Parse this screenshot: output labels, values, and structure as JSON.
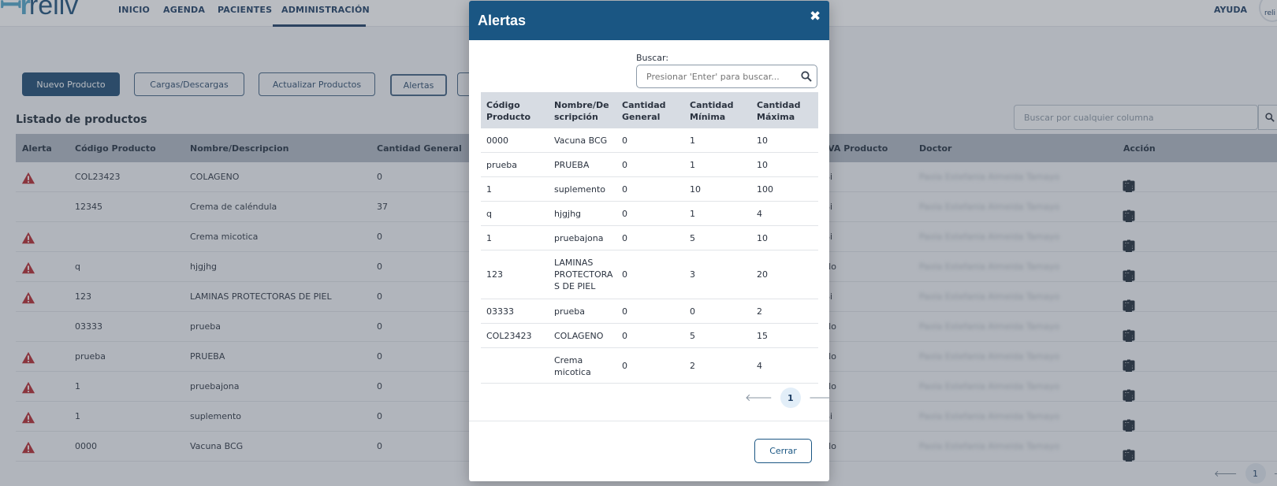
{
  "nav": {
    "logo": "reliv",
    "items": [
      "INICIO",
      "AGENDA",
      "PACIENTES",
      "ADMINISTRACIÓN"
    ],
    "help": "AYUDA",
    "avatar_text": "reli"
  },
  "toolbar": {
    "new_product": "Nuevo Producto",
    "loads": "Cargas/Descargas",
    "update_products": "Actualizar Productos",
    "alerts": "Alertas"
  },
  "list": {
    "title": "Listado de productos",
    "search_placeholder": "Buscar por cualquier columna",
    "columns": [
      "Alerta",
      "Código Producto",
      "Nombre/Descripcion",
      "Cantidad General",
      "IVA Producto",
      "Doctor",
      "Acción"
    ],
    "rows": [
      {
        "alert": true,
        "code": "COL23423",
        "name": "COLAGENO",
        "qty": "0",
        "iva": "Si",
        "doctor": "Paola Estefania Almeida Tamayo"
      },
      {
        "alert": false,
        "code": "12345",
        "name": "Crema de caléndula",
        "qty": "37",
        "iva": "Si",
        "doctor": "Paola Estefania Almeida Tamayo"
      },
      {
        "alert": true,
        "code": "",
        "name": "Crema micotica",
        "qty": "0",
        "iva": "Si",
        "doctor": "Paola Estefania Almeida Tamayo"
      },
      {
        "alert": true,
        "code": "q",
        "name": "hjgjhg",
        "qty": "0",
        "iva": "No",
        "doctor": "Paola Estefania Almeida Tamayo"
      },
      {
        "alert": true,
        "code": "123",
        "name": "LAMINAS PROTECTORAS DE PIEL",
        "qty": "0",
        "iva": "Si",
        "doctor": "Paola Estefania Almeida Tamayo"
      },
      {
        "alert": false,
        "code": "03333",
        "name": "prueba",
        "qty": "0",
        "iva": "No",
        "doctor": "Paola Estefania Almeida Tamayo"
      },
      {
        "alert": true,
        "code": "prueba",
        "name": "PRUEBA",
        "qty": "0",
        "iva": "No",
        "doctor": "Paola Estefania Almeida Tamayo"
      },
      {
        "alert": true,
        "code": "1",
        "name": "pruebajona",
        "qty": "0",
        "iva": "No",
        "doctor": "Paola Estefania Almeida Tamayo"
      },
      {
        "alert": true,
        "code": "1",
        "name": "suplemento",
        "qty": "0",
        "iva": "Si",
        "doctor": "Paola Estefania Almeida Tamayo"
      },
      {
        "alert": true,
        "code": "0000",
        "name": "Vacuna BCG",
        "qty": "0",
        "iva": "No",
        "doctor": "Paola Estefania Almeida Tamayo"
      }
    ],
    "page": "1"
  },
  "modal": {
    "title": "Alertas",
    "close_symbol": "✖",
    "search_label": "Buscar:",
    "search_placeholder": "Presionar 'Enter' para buscar...",
    "columns": [
      "Código Producto",
      "Nombre/De scripción",
      "Cantidad General",
      "Cantidad Mínima",
      "Cantidad Máxima"
    ],
    "rows": [
      {
        "code": "0000",
        "name": "Vacuna BCG",
        "general": "0",
        "min": "1",
        "max": "10"
      },
      {
        "code": "prueba",
        "name": "PRUEBA",
        "general": "0",
        "min": "1",
        "max": "10"
      },
      {
        "code": "1",
        "name": "suplemento",
        "general": "0",
        "min": "10",
        "max": "100"
      },
      {
        "code": "q",
        "name": "hjgjhg",
        "general": "0",
        "min": "1",
        "max": "4"
      },
      {
        "code": "1",
        "name": "pruebajona",
        "general": "0",
        "min": "5",
        "max": "10"
      },
      {
        "code": "123",
        "name": "LAMINAS PROTECTORA S DE PIEL",
        "general": "0",
        "min": "3",
        "max": "20"
      },
      {
        "code": "03333",
        "name": "prueba",
        "general": "0",
        "min": "0",
        "max": "2"
      },
      {
        "code": "COL23423",
        "name": "COLAGENO",
        "general": "0",
        "min": "5",
        "max": "15"
      },
      {
        "code": "",
        "name": "Crema micotica",
        "general": "0",
        "min": "2",
        "max": "4"
      }
    ],
    "page": "1",
    "close_button": "Cerrar"
  },
  "icons": {
    "alert": "warning-triangle-icon",
    "add": "plus-icon",
    "list": "list-icon",
    "edit": "pencil-icon",
    "delete": "trash-icon",
    "search": "search-icon"
  },
  "colors": {
    "brand_dark": "#1a5683",
    "nav_text": "#1c3d63",
    "alert_red": "#b3262d"
  }
}
